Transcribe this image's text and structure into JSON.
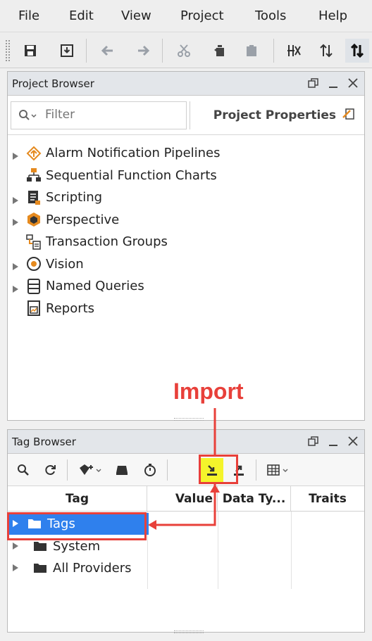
{
  "menu": [
    "File",
    "Edit",
    "View",
    "Project",
    "Tools",
    "Help"
  ],
  "toolbar_icons": [
    "save-icon",
    "save-all-icon",
    "undo-icon",
    "redo-icon",
    "cut-icon",
    "copy-icon",
    "paste-icon",
    "communication-off-icon",
    "read-only-icon",
    "read-write-icon"
  ],
  "project_browser": {
    "title": "Project Browser",
    "filter_placeholder": "Filter",
    "properties_label": "Project Properties",
    "items": [
      {
        "label": "Alarm Notification Pipelines",
        "expandable": true,
        "icon": "pipeline-icon",
        "color": "#e58a1f"
      },
      {
        "label": "Sequential Function Charts",
        "expandable": false,
        "icon": "sfc-icon",
        "color": "#e58a1f"
      },
      {
        "label": "Scripting",
        "expandable": true,
        "icon": "script-icon",
        "color": "#333333"
      },
      {
        "label": "Perspective",
        "expandable": true,
        "icon": "perspective-icon",
        "color": "#e58a1f"
      },
      {
        "label": "Transaction Groups",
        "expandable": false,
        "icon": "transaction-icon",
        "color": "#e58a1f"
      },
      {
        "label": "Vision",
        "expandable": true,
        "icon": "vision-icon",
        "color": "#e58a1f"
      },
      {
        "label": "Named Queries",
        "expandable": true,
        "icon": "database-icon",
        "color": "#333333"
      },
      {
        "label": "Reports",
        "expandable": false,
        "icon": "report-icon",
        "color": "#333333"
      }
    ]
  },
  "annotation": {
    "label": "Import",
    "color": "#e8403a",
    "highlight": "#f4f42b"
  },
  "tag_browser": {
    "title": "Tag Browser",
    "columns": [
      "Tag",
      "Value",
      "Data Ty...",
      "Traits"
    ],
    "rows": [
      {
        "label": "Tags",
        "selected": true
      },
      {
        "label": "System",
        "selected": false
      },
      {
        "label": "All Providers",
        "selected": false
      }
    ]
  },
  "colors": {
    "selection": "#2f80ed",
    "accent": "#e58a1f",
    "annotation": "#e8403a"
  }
}
